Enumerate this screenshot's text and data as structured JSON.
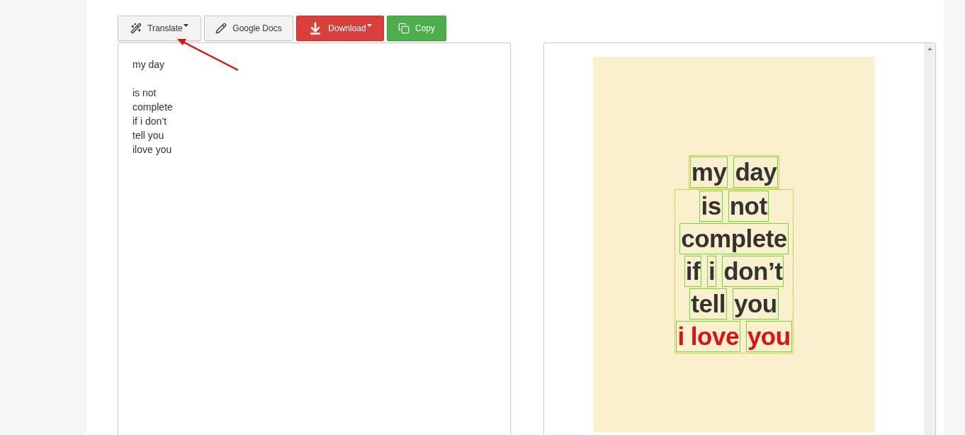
{
  "toolbar": {
    "buttons": [
      {
        "label": "Translate",
        "kind": "default",
        "dropdown": true
      },
      {
        "label": "Google Docs",
        "kind": "default",
        "dropdown": false
      },
      {
        "label": "Download",
        "kind": "danger",
        "dropdown": true
      },
      {
        "label": "Copy",
        "kind": "success",
        "dropdown": false
      }
    ]
  },
  "text_editor": {
    "paragraphs": [
      [
        "my day"
      ],
      [
        "is not",
        "complete",
        "if i don’t",
        "tell you",
        "ilove you"
      ]
    ]
  },
  "preview": {
    "blocks": [
      {
        "lines": [
          [
            {
              "text": "my",
              "color": "#333333"
            },
            {
              "text": "day",
              "color": "#333333"
            }
          ]
        ]
      },
      {
        "lines": [
          [
            {
              "text": "is",
              "color": "#333333"
            },
            {
              "text": "not",
              "color": "#333333"
            }
          ],
          [
            {
              "text": "complete",
              "color": "#333333"
            }
          ],
          [
            {
              "text": "if",
              "color": "#333333"
            },
            {
              "text": "i",
              "color": "#333333"
            },
            {
              "text": "don’t",
              "color": "#333333"
            }
          ],
          [
            {
              "text": "tell",
              "color": "#333333"
            },
            {
              "text": "you",
              "color": "#333333"
            }
          ],
          [
            {
              "text": "i love",
              "color": "#dd1111"
            },
            {
              "text": "you",
              "color": "#dd1111"
            }
          ]
        ]
      }
    ]
  }
}
